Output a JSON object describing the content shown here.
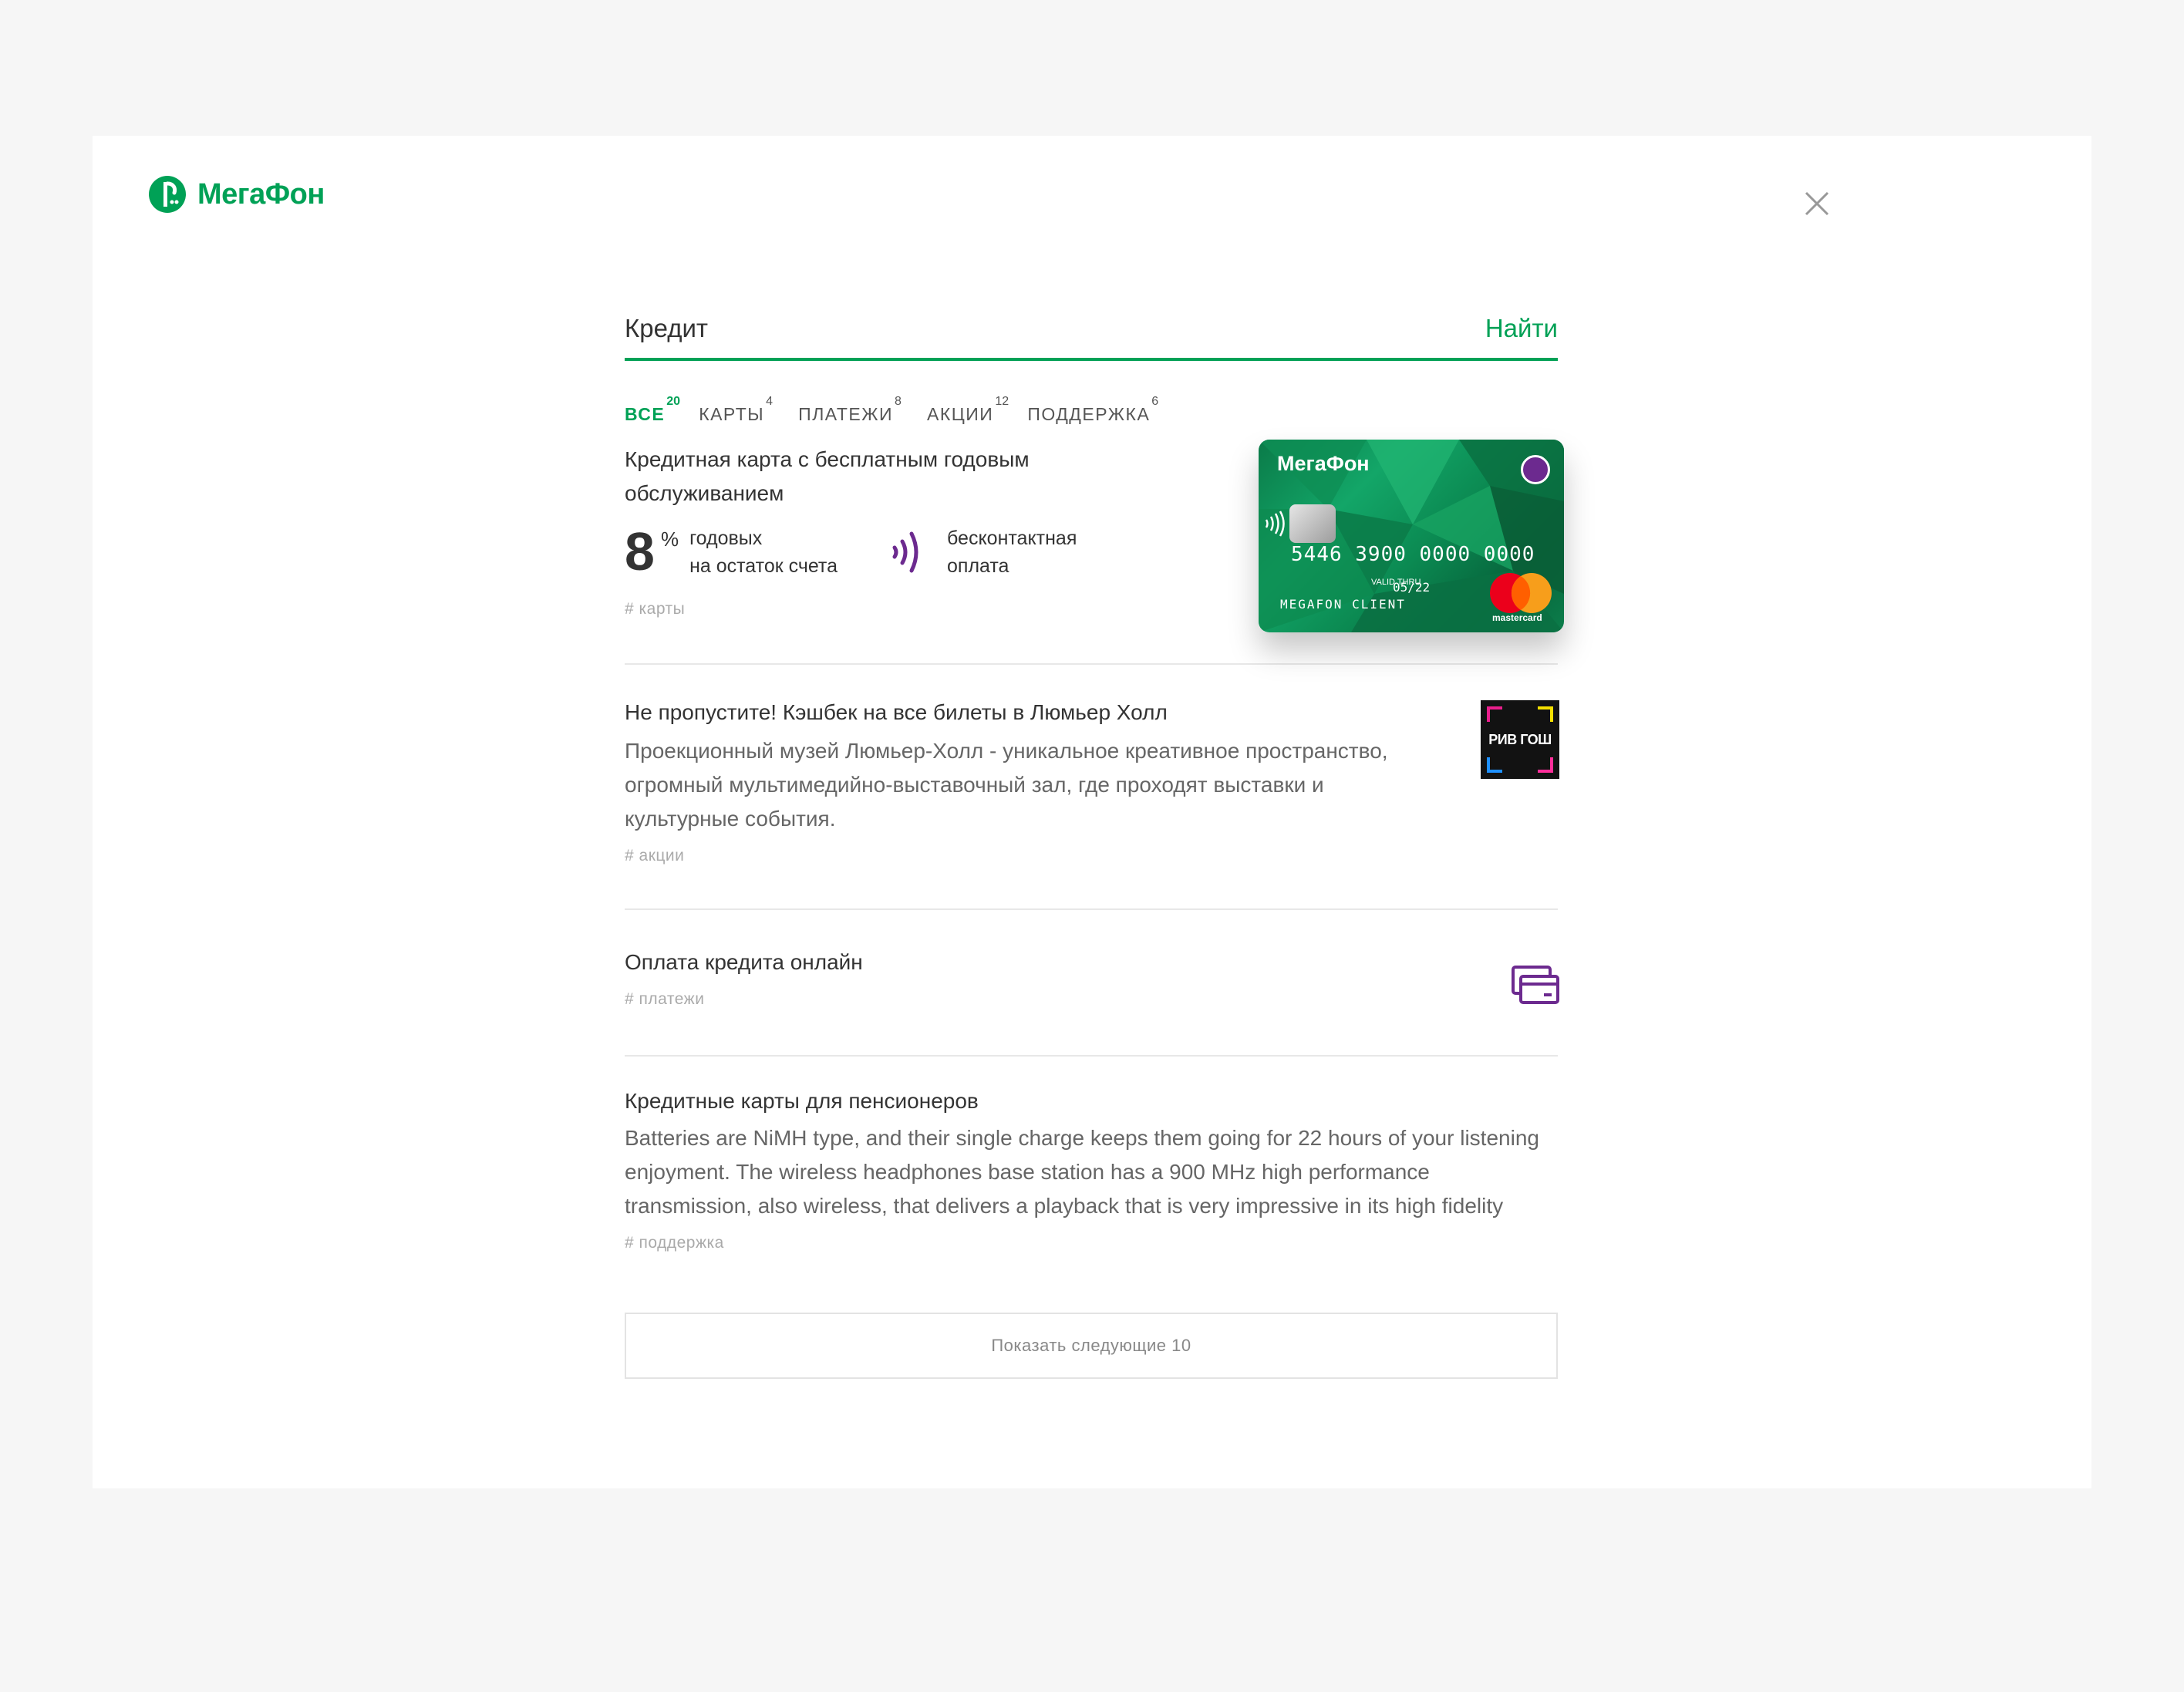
{
  "brand": {
    "name": "МегаФон",
    "color": "#00a156"
  },
  "search": {
    "query": "Кредит",
    "button": "Найти"
  },
  "tabs": [
    {
      "label": "ВСЕ",
      "count": "20",
      "active": true
    },
    {
      "label": "КАРТЫ",
      "count": "4"
    },
    {
      "label": "ПЛАТЕЖИ",
      "count": "8"
    },
    {
      "label": "АКЦИИ",
      "count": "12"
    },
    {
      "label": "ПОДДЕРЖКА",
      "count": "6"
    }
  ],
  "results": [
    {
      "title": "Кредитная карта с бесплатным годовым обслуживанием",
      "rate": {
        "value": "8",
        "unit": "%",
        "line1": "годовых",
        "line2": "на остаток счета"
      },
      "contactless": {
        "line1": "бесконтактная",
        "line2": "оплата",
        "icon": "contactless-icon"
      },
      "tag": "# карты",
      "card": {
        "brand": "МегаФон",
        "number": "5446 3900 0000 0000",
        "valid_label": "VALID THRU",
        "expiry": "05/22",
        "holder": "MEGAFON CLIENT",
        "network": "mastercard"
      }
    },
    {
      "title": "Не пропустите! Кэшбек на все билеты в Люмьер Холл",
      "description": "Проекционный музей Люмьер-Холл - уникальное креативное пространство, огромный мультимедийно-выставочный зал, где проходят выставки и культурные события.",
      "tag": "# акции",
      "logo_text": "РИВ ГОШ"
    },
    {
      "title": "Оплата кредита онлайн",
      "tag": "# платежи",
      "icon": "card-payment-icon"
    },
    {
      "title": "Кредитные карты для пенсионеров",
      "description": "Batteries are NiMH type, and their single charge keeps them going for 22 hours of your listening enjoyment. The wireless headphones base station has a 900 MHz high performance transmission, also wireless, that delivers a playback that is very impressive in its high fidelity",
      "tag": "# поддержка"
    }
  ],
  "more_button": "Показать следующие 10",
  "colors": {
    "accent": "#00a156",
    "purple": "#6c2a8f",
    "divider": "#e8e8e8"
  }
}
